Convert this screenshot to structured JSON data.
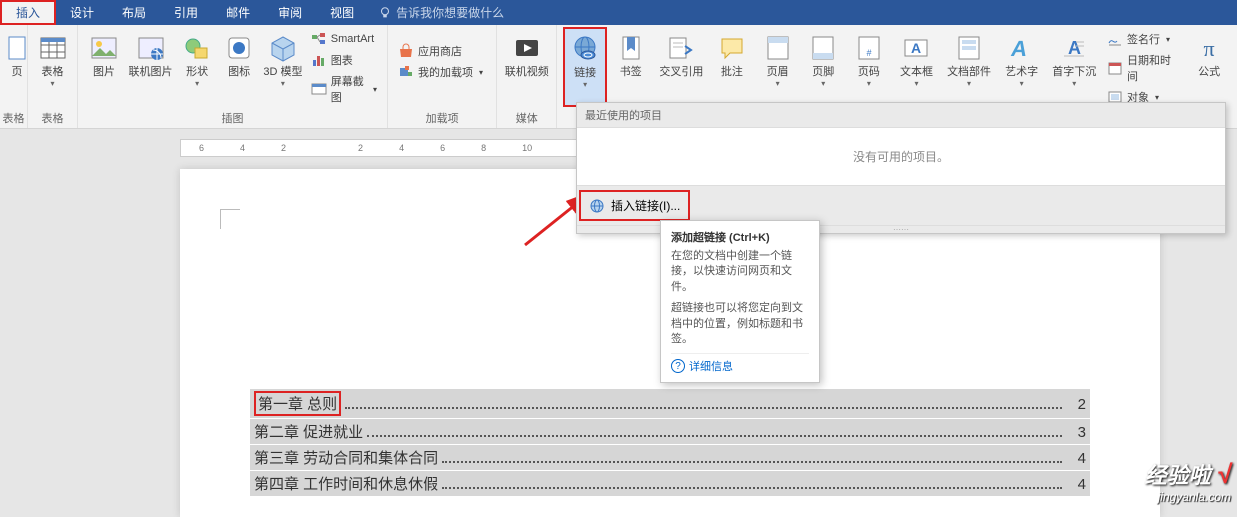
{
  "tabs": {
    "insert": "插入",
    "design": "设计",
    "layout": "布局",
    "references": "引用",
    "mail": "邮件",
    "review": "审阅",
    "view": "视图",
    "tellme": "告诉我你想要做什么"
  },
  "ribbon": {
    "page_group": "页",
    "table_group": "表格",
    "illus_group": "插图",
    "addins_group": "加载项",
    "media_group": "媒体",
    "table": "表格",
    "picture": "图片",
    "online_pic": "联机图片",
    "shapes": "形状",
    "icons": "图标",
    "model3d": "3D 模型",
    "smartart": "SmartArt",
    "chart": "图表",
    "screenshot": "屏幕截图",
    "store": "应用商店",
    "myaddins": "我的加载项",
    "online_video": "联机视频",
    "link": "链接",
    "bookmark": "书签",
    "crossref": "交叉引用",
    "comment": "批注",
    "header": "页眉",
    "footer": "页脚",
    "pagenum": "页码",
    "textbox": "文本框",
    "quickparts": "文档部件",
    "wordart": "艺术字",
    "dropcap": "首字下沉",
    "sigline": "签名行",
    "datetime": "日期和时间",
    "object": "对象",
    "equation": "公式"
  },
  "dropdown": {
    "recent_header": "最近使用的项目",
    "no_items": "没有可用的项目。",
    "insert_link": "插入链接(I)..."
  },
  "tooltip": {
    "title": "添加超链接 (Ctrl+K)",
    "p1": "在您的文档中创建一个链接，以快速访问网页和文件。",
    "p2": "超链接也可以将您定向到文档中的位置，例如标题和书签。",
    "more": "详细信息"
  },
  "ruler_marks": [
    "6",
    "4",
    "2",
    "",
    "2",
    "4",
    "6",
    "8",
    "10"
  ],
  "toc": [
    {
      "title": "第一章  总则",
      "page": "2",
      "highlight": true
    },
    {
      "title": "第二章  促进就业",
      "page": "3",
      "highlight": false
    },
    {
      "title": "第三章  劳动合同和集体合同",
      "page": "4",
      "highlight": false
    },
    {
      "title": "第四章  工作时间和休息休假",
      "page": "4",
      "highlight": false
    }
  ],
  "watermark": {
    "brand": "经验啦",
    "check": "√",
    "url": "jingyanla.com"
  }
}
